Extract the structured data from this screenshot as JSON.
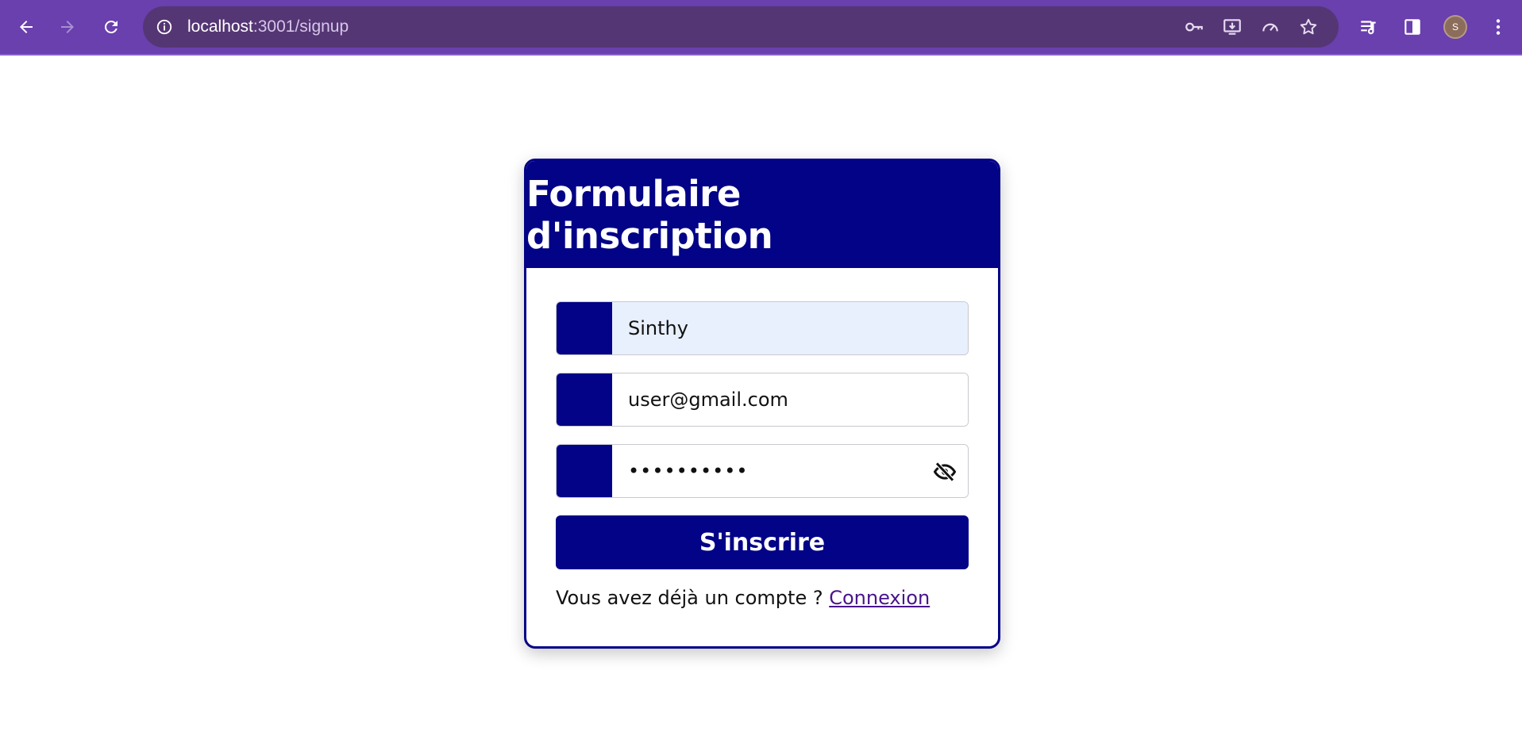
{
  "browser": {
    "url_host": "localhost",
    "url_rest": ":3001/signup",
    "avatar_letter": "S",
    "icons": {
      "back": "arrow-left-icon",
      "forward": "arrow-right-icon",
      "reload": "reload-icon",
      "site_info": "info-icon",
      "passwords": "key-icon",
      "install": "install-app-icon",
      "performance": "speedometer-icon",
      "bookmark": "star-icon",
      "media": "media-queue-icon",
      "side_panel": "side-panel-icon",
      "menu": "kebab-menu-icon"
    },
    "colors": {
      "toolbar": "#6a3fae",
      "omnibox": "#553674"
    }
  },
  "signup": {
    "title": "Formulaire d'inscription",
    "fields": {
      "name": {
        "value": "Sinthy",
        "autofilled": true
      },
      "email": {
        "value": "user@gmail.com"
      },
      "password": {
        "value": "••••••••••",
        "toggle_icon": "eye-slash-icon"
      }
    },
    "submit_label": "S'inscrire",
    "login_prompt": "Vous avez déjà un compte ? ",
    "login_link": "Connexion",
    "colors": {
      "primary": "#030387",
      "autofill_bg": "#e8f0fe",
      "link": "#4a148c"
    }
  }
}
